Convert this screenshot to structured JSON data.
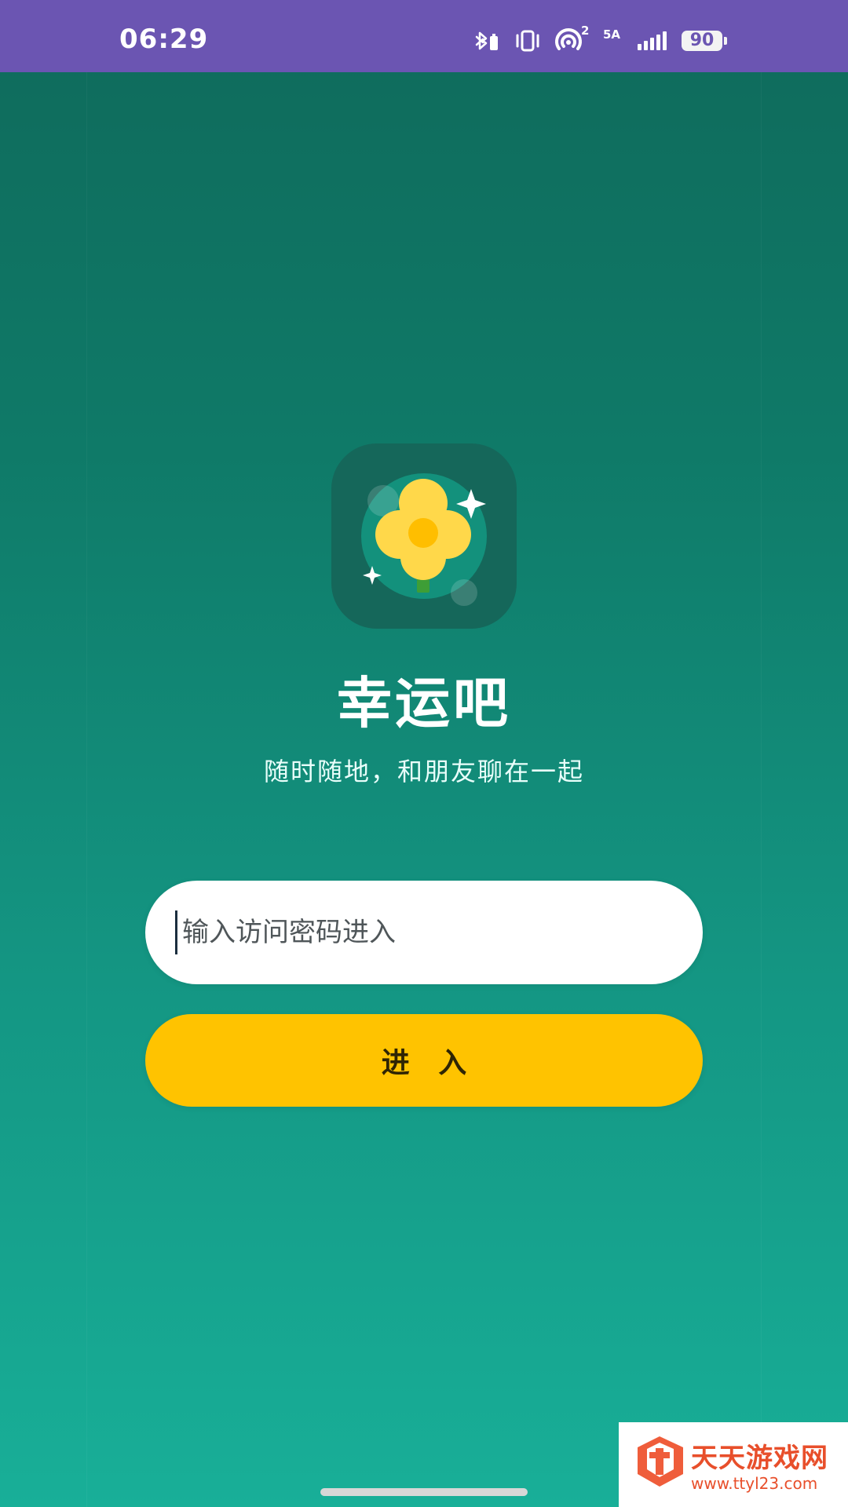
{
  "status_bar": {
    "time": "06:29",
    "network_label": "5A",
    "hotspot_count": "2",
    "battery": "90",
    "icons": [
      "bluetooth-battery-icon",
      "vibrate-icon",
      "hotspot-icon",
      "signal-icon",
      "battery-icon"
    ],
    "background": "#6b55b2"
  },
  "app": {
    "title": "幸运吧",
    "subtitle": "随时随地，和朋友聊在一起",
    "logo": "clover-flower-logo"
  },
  "login": {
    "password_placeholder": "输入访问密码进入",
    "password_value": "",
    "enter_label": "进 入",
    "accent": "#ffc300"
  },
  "watermark": {
    "title": "天天游戏网",
    "url": "www.ttyl23.com"
  },
  "theme": {
    "background_top": "#0f6a5b",
    "background_bottom": "#18af98",
    "text": "#ffffff"
  }
}
